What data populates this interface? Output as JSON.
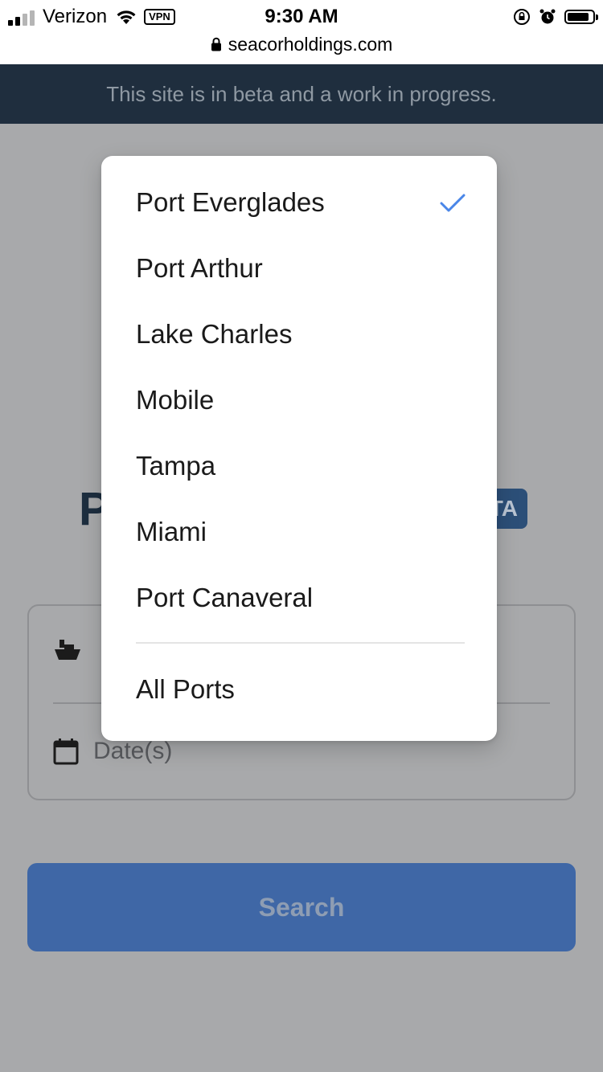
{
  "status_bar": {
    "carrier": "Verizon",
    "vpn": "VPN",
    "time": "9:30 AM",
    "url": "seacorholdings.com"
  },
  "banner": {
    "text": "This site is in beta and a work in progress."
  },
  "page": {
    "logo_visible_letter": "P",
    "badge_visible_text": "TA",
    "vessel_icon": "ship-icon",
    "date_icon": "calendar-icon",
    "date_placeholder": "Date(s)",
    "search_label": "Search",
    "accent_color": "#3f67a6"
  },
  "menu": {
    "selected": "Port Everglades",
    "check_color": "#4a86e8",
    "items": [
      {
        "label": "Port Everglades",
        "selected": true
      },
      {
        "label": "Port Arthur",
        "selected": false
      },
      {
        "label": "Lake Charles",
        "selected": false
      },
      {
        "label": "Mobile",
        "selected": false
      },
      {
        "label": "Tampa",
        "selected": false
      },
      {
        "label": "Miami",
        "selected": false
      },
      {
        "label": "Port Canaveral",
        "selected": false
      }
    ],
    "all_ports_label": "All Ports"
  }
}
